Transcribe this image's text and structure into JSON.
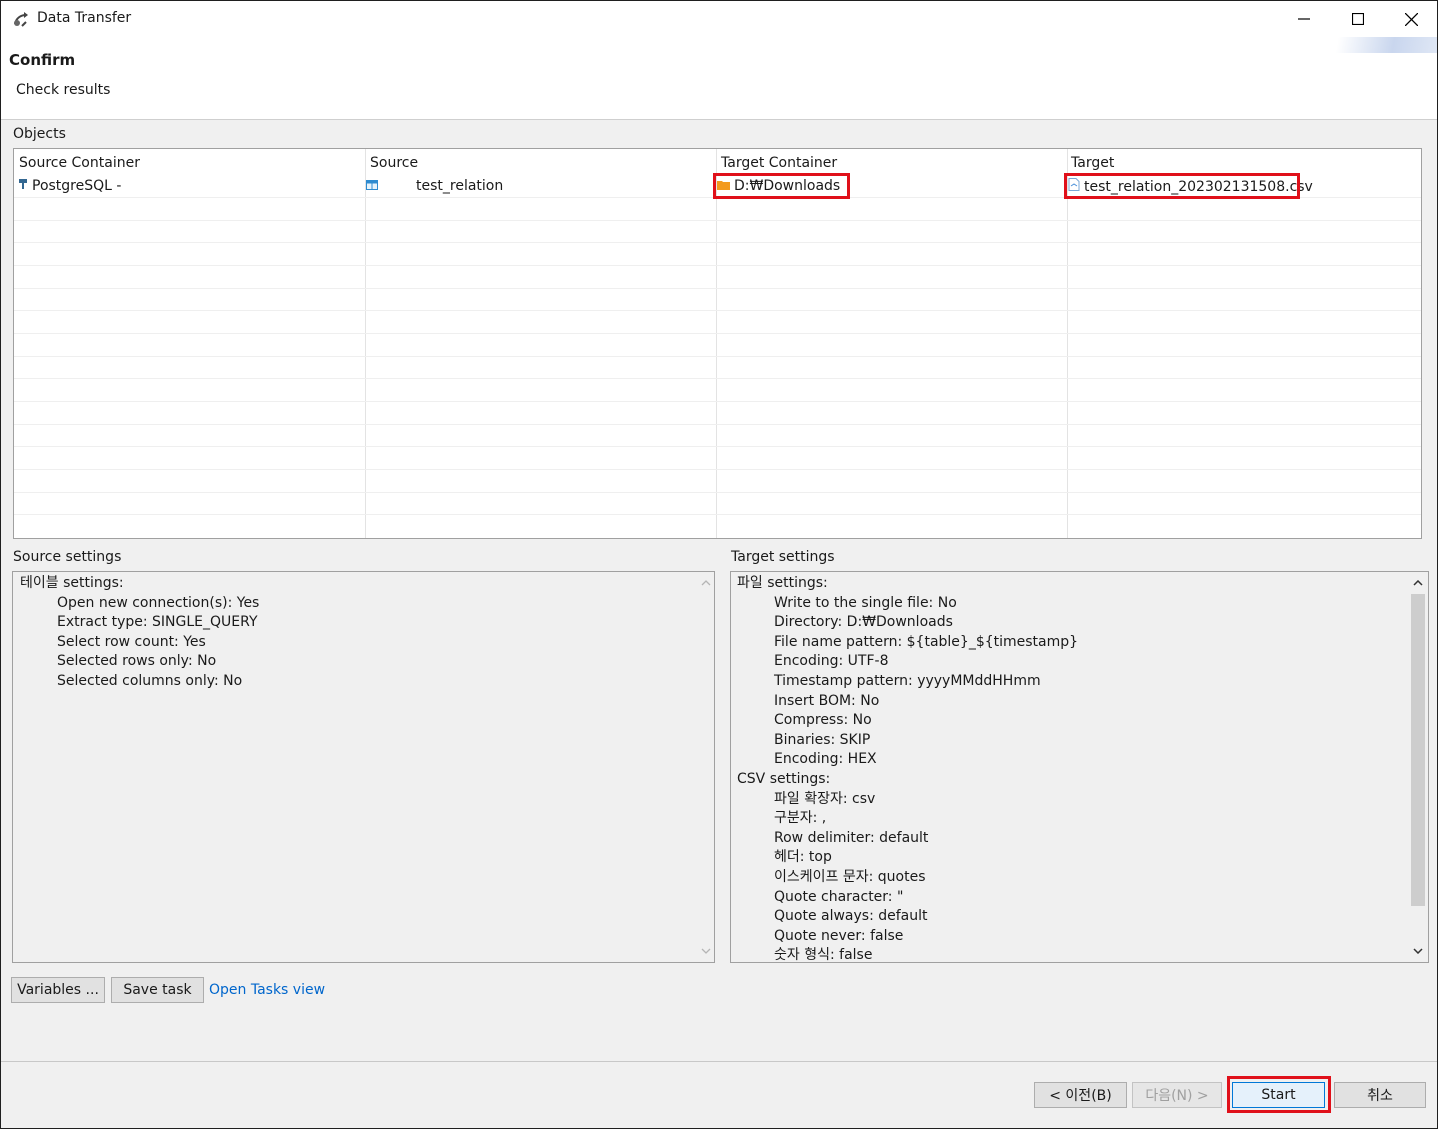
{
  "window": {
    "title": "Data Transfer"
  },
  "header": {
    "title": "Confirm",
    "description": "Check results"
  },
  "objects": {
    "label": "Objects",
    "columns": [
      "Source Container",
      "Source",
      "Target Container",
      "Target"
    ],
    "rows": [
      {
        "source_container": "PostgreSQL -",
        "source": "test_relation",
        "target_container": "D:₩Downloads",
        "target": "test_relation_202302131508.csv"
      }
    ]
  },
  "source_settings": {
    "label": "Source settings",
    "lines": [
      {
        "text": "테이블 settings:",
        "indent": false
      },
      {
        "text": "Open new connection(s): Yes",
        "indent": true
      },
      {
        "text": "Extract type: SINGLE_QUERY",
        "indent": true
      },
      {
        "text": "Select row count: Yes",
        "indent": true
      },
      {
        "text": "Selected rows only: No",
        "indent": true
      },
      {
        "text": "Selected columns only: No",
        "indent": true
      }
    ]
  },
  "target_settings": {
    "label": "Target settings",
    "lines": [
      {
        "text": "파일 settings:",
        "indent": false
      },
      {
        "text": "Write to the single file: No",
        "indent": true
      },
      {
        "text": "Directory: D:₩Downloads",
        "indent": true
      },
      {
        "text": "File name pattern: ${table}_${timestamp}",
        "indent": true
      },
      {
        "text": "Encoding: UTF-8",
        "indent": true
      },
      {
        "text": "Timestamp pattern: yyyyMMddHHmm",
        "indent": true
      },
      {
        "text": "Insert BOM: No",
        "indent": true
      },
      {
        "text": "Compress: No",
        "indent": true
      },
      {
        "text": "Binaries: SKIP",
        "indent": true
      },
      {
        "text": "Encoding: HEX",
        "indent": true
      },
      {
        "text": "CSV settings:",
        "indent": false
      },
      {
        "text": "파일 확장자: csv",
        "indent": true
      },
      {
        "text": "구분자: ,",
        "indent": true
      },
      {
        "text": "Row delimiter: default",
        "indent": true
      },
      {
        "text": "헤더: top",
        "indent": true
      },
      {
        "text": "이스케이프 문자: quotes",
        "indent": true
      },
      {
        "text": "Quote character: \"",
        "indent": true
      },
      {
        "text": "Quote always: default",
        "indent": true
      },
      {
        "text": "Quote never: false",
        "indent": true
      },
      {
        "text": "숫자 형식: false",
        "indent": true
      }
    ]
  },
  "actions": {
    "variables": "Variables ...",
    "save_task": "Save task",
    "open_tasks_view": "Open Tasks view"
  },
  "footer": {
    "back": "< 이전(B)",
    "next": "다음(N) >",
    "start": "Start",
    "cancel": "취소"
  },
  "colors": {
    "highlight": "#e0101a",
    "link": "#0066cc",
    "folder": "#f39a1e"
  },
  "icons": {
    "app": "data-transfer-icon",
    "source_container": "postgresql-icon",
    "source": "table-icon",
    "target_container": "folder-icon",
    "target": "csv-file-icon"
  }
}
